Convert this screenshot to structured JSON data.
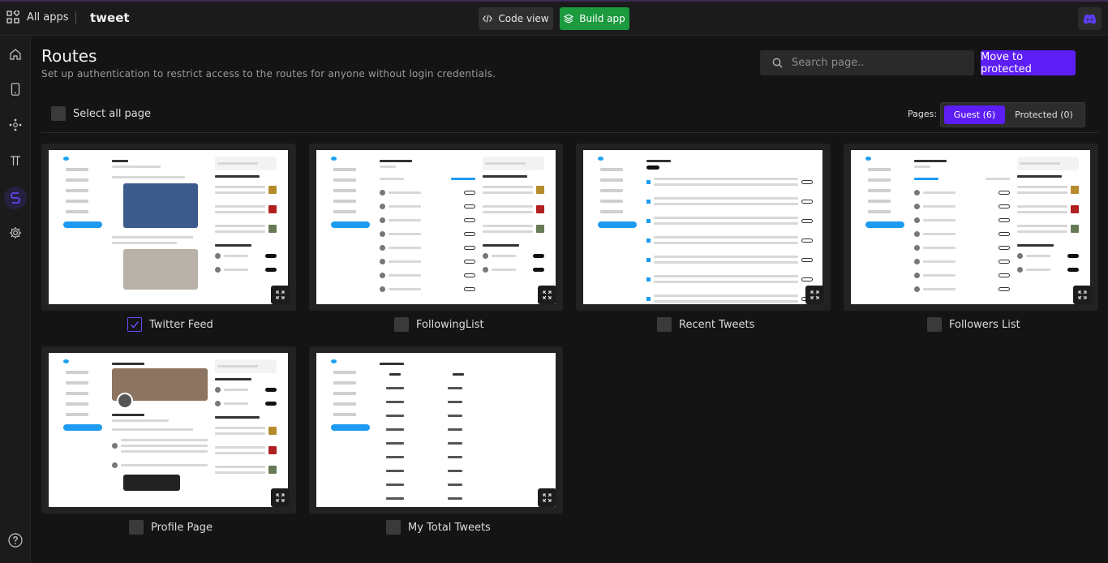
{
  "topbar": {
    "all_apps_label": "All apps",
    "app_name": "tweet",
    "code_view_label": "Code view",
    "build_app_label": "Build app"
  },
  "header": {
    "title": "Routes",
    "subtitle": "Set up authentication to restrict access to the routes for anyone without login credentials.",
    "search_placeholder": "Search page..",
    "move_button_label": "Move to protected"
  },
  "controls": {
    "select_all_label": "Select all page",
    "pages_label": "Pages:",
    "guest_tab_label": "Guest (6)",
    "protected_tab_label": "Protected (0)"
  },
  "routes": [
    {
      "name": "Twitter Feed",
      "checked": true
    },
    {
      "name": "FollowingList",
      "checked": false
    },
    {
      "name": "Recent Tweets",
      "checked": false
    },
    {
      "name": "Followers List",
      "checked": false
    },
    {
      "name": "Profile Page",
      "checked": false
    },
    {
      "name": "My Total Tweets",
      "checked": false
    }
  ],
  "colors": {
    "accent": "#5d1ef5",
    "build_green": "#1b9a3e",
    "background": "#141414",
    "card": "#222222"
  }
}
